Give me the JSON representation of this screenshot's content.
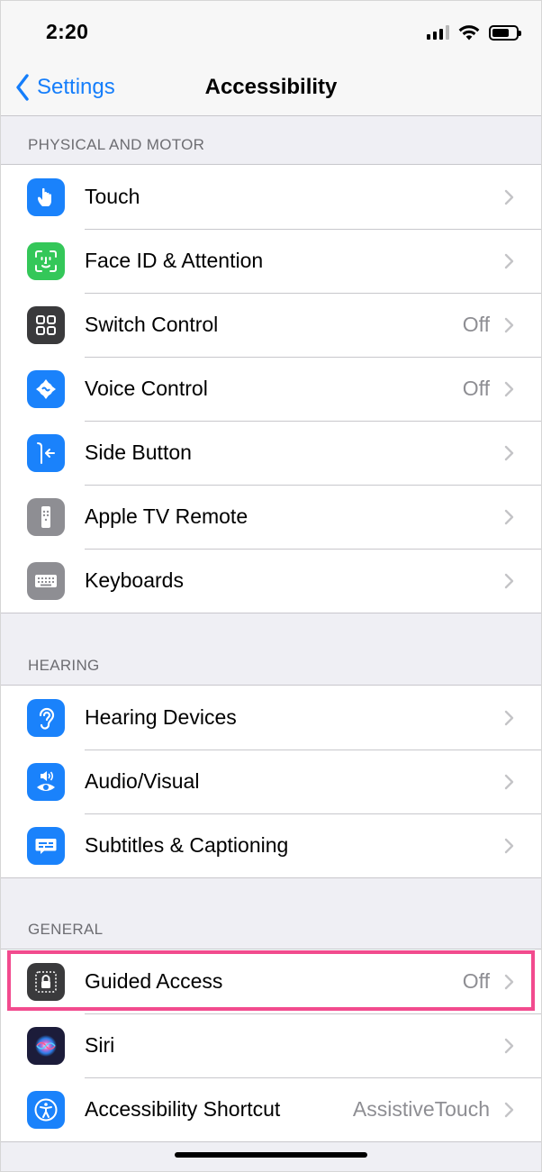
{
  "status_bar": {
    "time": "2:20"
  },
  "nav": {
    "back_label": "Settings",
    "title": "Accessibility"
  },
  "sections": {
    "physical": {
      "header": "PHYSICAL AND MOTOR",
      "rows": [
        {
          "label": "Touch",
          "value": "",
          "icon": "touch-hand-icon",
          "color": "#1a82fb"
        },
        {
          "label": "Face ID & Attention",
          "value": "",
          "icon": "face-id-icon",
          "color": "#34c759"
        },
        {
          "label": "Switch Control",
          "value": "Off",
          "icon": "switch-control-icon",
          "color": "#3a3a3c"
        },
        {
          "label": "Voice Control",
          "value": "Off",
          "icon": "voice-control-icon",
          "color": "#1a82fb"
        },
        {
          "label": "Side Button",
          "value": "",
          "icon": "side-button-icon",
          "color": "#1a82fb"
        },
        {
          "label": "Apple TV Remote",
          "value": "",
          "icon": "tv-remote-icon",
          "color": "#8e8e93"
        },
        {
          "label": "Keyboards",
          "value": "",
          "icon": "keyboard-icon",
          "color": "#8e8e93"
        }
      ]
    },
    "hearing": {
      "header": "HEARING",
      "rows": [
        {
          "label": "Hearing Devices",
          "value": "",
          "icon": "ear-icon",
          "color": "#1a82fb"
        },
        {
          "label": "Audio/Visual",
          "value": "",
          "icon": "audio-visual-icon",
          "color": "#1a82fb"
        },
        {
          "label": "Subtitles & Captioning",
          "value": "",
          "icon": "subtitles-icon",
          "color": "#1a82fb"
        }
      ]
    },
    "general": {
      "header": "GENERAL",
      "rows": [
        {
          "label": "Guided Access",
          "value": "Off",
          "icon": "guided-access-lock-icon",
          "color": "#3a3a3c"
        },
        {
          "label": "Siri",
          "value": "",
          "icon": "siri-icon",
          "color": "#1c1c3a"
        },
        {
          "label": "Accessibility Shortcut",
          "value": "AssistiveTouch",
          "icon": "accessibility-icon",
          "color": "#1a82fb"
        }
      ]
    }
  },
  "highlight_color": "#f24b8e"
}
